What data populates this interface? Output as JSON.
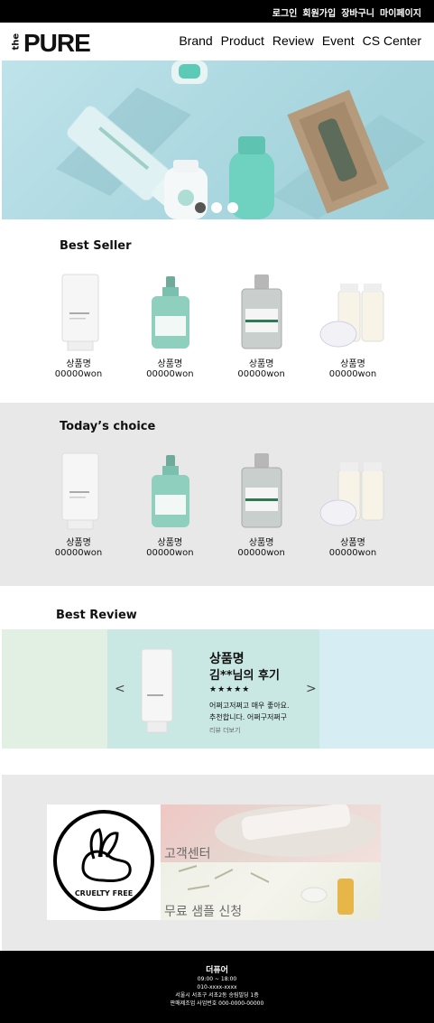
{
  "topbar": {
    "links": [
      "로그인",
      "회원가입",
      "장바구니",
      "마이페이지"
    ]
  },
  "header": {
    "logo_small": "the",
    "logo_main": "PURE",
    "nav": [
      "Brand",
      "Product",
      "Review",
      "Event",
      "CS Center"
    ]
  },
  "hero": {
    "slide_count": 3,
    "active_slide": 1
  },
  "best_seller": {
    "title": "Best Seller",
    "items": [
      {
        "name": "상품명",
        "price": "00000won",
        "icon": "tube-product"
      },
      {
        "name": "상품명",
        "price": "00000won",
        "icon": "serum-bottle-product"
      },
      {
        "name": "상품명",
        "price": "00000won",
        "icon": "glass-bottle-product"
      },
      {
        "name": "상품명",
        "price": "00000won",
        "icon": "cream-set-product"
      }
    ]
  },
  "todays_choice": {
    "title": "Today’s choice",
    "items": [
      {
        "name": "상품명",
        "price": "00000won",
        "icon": "tube-product"
      },
      {
        "name": "상품명",
        "price": "00000won",
        "icon": "serum-bottle-product"
      },
      {
        "name": "상품명",
        "price": "00000won",
        "icon": "glass-bottle-product"
      },
      {
        "name": "상품명",
        "price": "00000won",
        "icon": "cream-set-product"
      }
    ]
  },
  "best_review": {
    "title": "Best Review",
    "product_name": "상품명",
    "reviewer_line": "김**님의 후기",
    "stars": "★★★★★",
    "text_line1": "어쩌고저쩌고 매우 좋아요.",
    "text_line2": "추천합니다. 어쩌구저쩌구",
    "more": "리뷰 더보기",
    "prev_arrow": "<",
    "next_arrow": ">"
  },
  "info": {
    "cruelty_label": "CRUELTY FREE",
    "cs_label": "고객센터",
    "sample_label": "무료 샘플 신청"
  },
  "footer": {
    "company": "더퓨어",
    "hours": "09:00 ~ 18:00",
    "phone": "010-xxxx-xxxx",
    "address": "서울시 서초구 서초2동 송림빌딩 1층",
    "business": "판매제조업 사업번호 000-0000-00000"
  },
  "colors": {
    "topbar": "#000000",
    "hero": "#a9d6df",
    "mint": "#7cc9b5",
    "review_bg": "#c9e8e3",
    "section_gray": "#e8e8e8"
  }
}
